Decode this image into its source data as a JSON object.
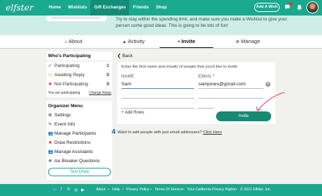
{
  "brand": {
    "logo": "elfster"
  },
  "nav": {
    "items": [
      "Home",
      "Wishlists",
      "Gift Exchanges",
      "Friends",
      "Shop"
    ],
    "add_wish": "Add A Wish"
  },
  "hero": {
    "text": "Try to stay within the spending limit, and make sure you make a Wishlist to give your person some good ideas. This is going to be lots of fun!"
  },
  "tabs": {
    "about": "About",
    "activity": "Activity",
    "invite": "Invite",
    "manage": "Manage"
  },
  "participating": {
    "title": "Who's Participating",
    "rows": [
      {
        "label": "Participating",
        "count": "1"
      },
      {
        "label": "Awaiting Reply",
        "count": "0"
      },
      {
        "label": "Not Participating",
        "count": "0"
      }
    ],
    "you_text": "You are participating",
    "change_reply": "Change Reply"
  },
  "organizer": {
    "title": "Organizer Menu",
    "items": [
      "Settings",
      "Event Info",
      "Manage Participants",
      "Draw Restrictions",
      "Manage Assistants",
      "Ice Breaker Questions"
    ],
    "test_draw": "Test Draw"
  },
  "invite": {
    "back": "Back",
    "instructions": "Enter the first name and emails of people that you'd like to invite.",
    "name_label": "NAME",
    "email_label": "EMAIL *",
    "name_value": "Sam",
    "email_value": "samjones@gmail.com",
    "add_rows": "+ Add Rows",
    "invite_button": "Invite",
    "want_more_number": "4",
    "want_more_text": "Want to add people with just email addresses?",
    "click_here": "Click Here"
  },
  "footer": {
    "links": [
      "About",
      "Help",
      "Privacy Policy",
      "Terms Of Service",
      "Your California Privacy Rights"
    ],
    "copyright": "© 2021 Elfster, Inc."
  },
  "colors": {
    "brand": "#1aa88f",
    "invite_button": "#168a72",
    "arrow": "#e0456a"
  }
}
